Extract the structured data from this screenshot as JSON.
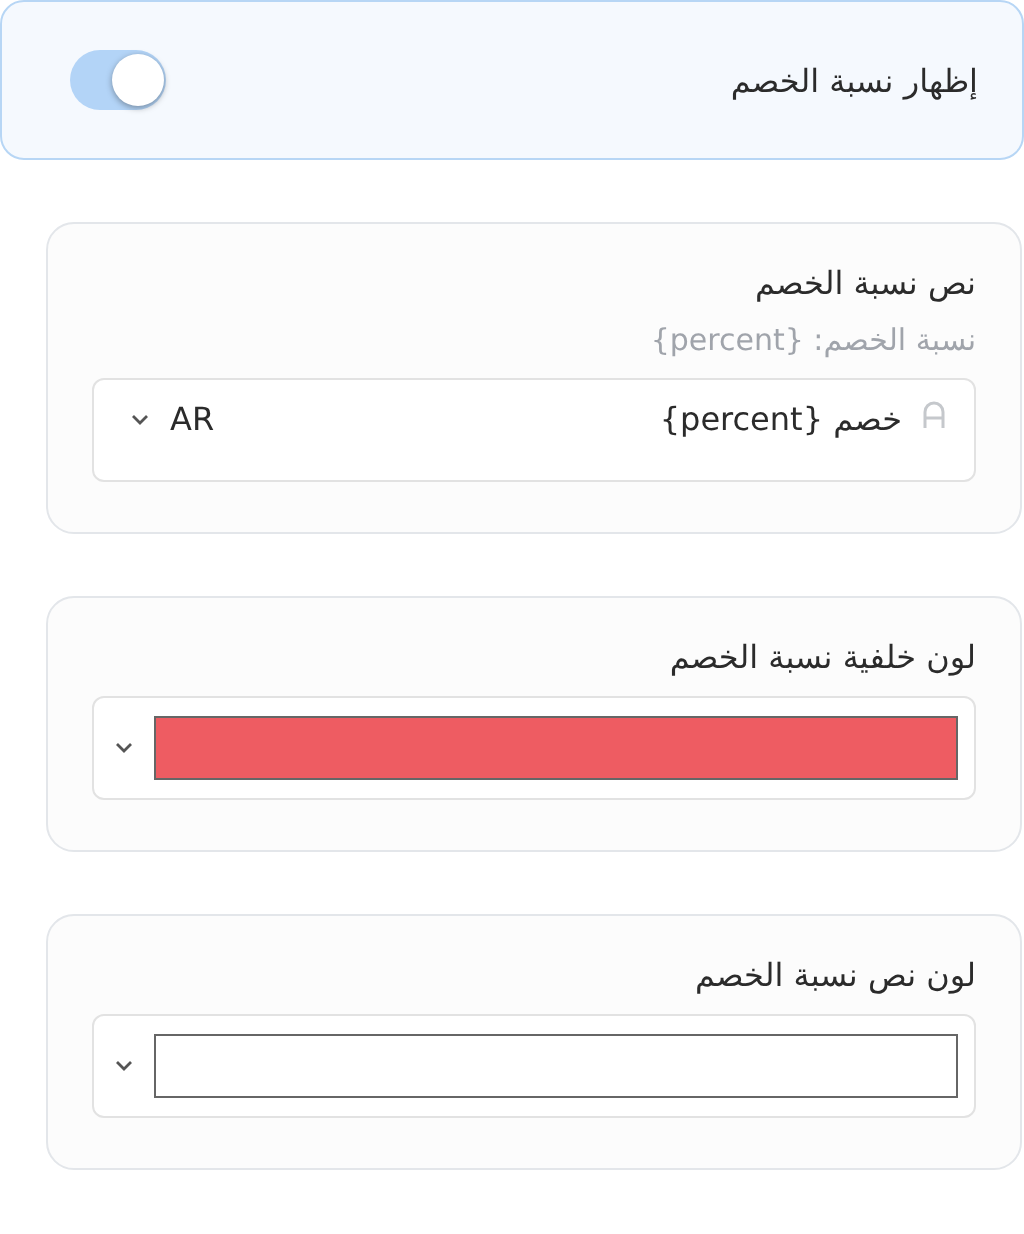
{
  "toggle": {
    "label": "إظهار نسبة الخصم",
    "on": true
  },
  "sections": [
    {
      "kind": "text",
      "title": "نص نسبة الخصم",
      "hint": "نسبة الخصم: {percent}",
      "value": "خصم {percent}",
      "language": "AR"
    },
    {
      "kind": "color",
      "title": "لون خلفية نسبة الخصم",
      "color": "#ee5c62"
    },
    {
      "kind": "color",
      "title": "لون نص نسبة الخصم",
      "color": "#ffffff"
    }
  ]
}
